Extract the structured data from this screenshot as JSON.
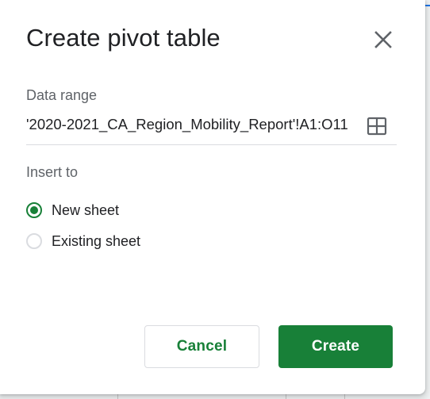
{
  "dialog": {
    "title": "Create pivot table",
    "close_icon": "close-icon",
    "data_range": {
      "label": "Data range",
      "value": "'2020-2021_CA_Region_Mobility_Report'!A1:O11",
      "select_icon": "grid-icon"
    },
    "insert_to": {
      "label": "Insert to",
      "options": [
        {
          "label": "New sheet",
          "selected": true
        },
        {
          "label": "Existing sheet",
          "selected": false
        }
      ]
    },
    "buttons": {
      "cancel": "Cancel",
      "create": "Create"
    }
  },
  "colors": {
    "accent": "#188038",
    "text": "#202124",
    "muted": "#5f6368",
    "border": "#dadce0"
  }
}
